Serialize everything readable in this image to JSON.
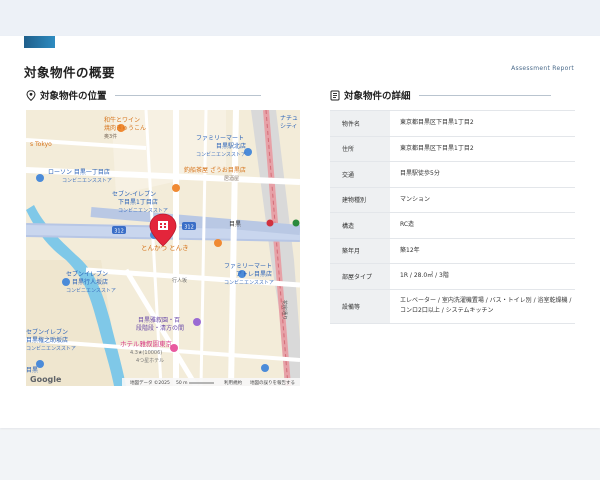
{
  "header": {
    "page_title": "対象物件の概要",
    "report_label": "Assessment Report"
  },
  "location_section": {
    "title": "対象物件の位置"
  },
  "details_section": {
    "title": "対象物件の詳細"
  },
  "details": [
    {
      "key": "物件名",
      "value": "東京都目黒区下目黒1丁目2"
    },
    {
      "key": "住所",
      "value": "東京都目黒区下目黒1丁目2"
    },
    {
      "key": "交通",
      "value": "目黒駅徒歩5分"
    },
    {
      "key": "建物種別",
      "value": "マンション"
    },
    {
      "key": "構造",
      "value": "RC造"
    },
    {
      "key": "築年月",
      "value": "築12年"
    },
    {
      "key": "部屋タイプ",
      "value": "1R / 28.0㎡ / 3階"
    },
    {
      "key": "設備等",
      "value": "エレベーター / 室内洗濯機置場 / バス・トイレ別 / 浴室乾燥機 / コンロ2口以上 / システムキッチン"
    }
  ],
  "map": {
    "labels": {
      "wine_bar": "和牛とワイン",
      "wine_bar2": "焼肉きゅうこん",
      "wine_bar3": "奥3件",
      "tokyo": "s Tokyo",
      "lawson": "ローソン 目黒一丁目店",
      "lawson_sub": "コンビニエンスストア",
      "famima_top": "ファミリーマート",
      "famima_top2": "目黒駅北店",
      "famima_top_sub": "コンビニエンスストア",
      "chitose": "ナチュ",
      "chitose2": "シティ",
      "ryotei": "釣船茶屋 ざうお目黒店",
      "ryotei_sub": "居酒屋",
      "seven_top": "セブン-イレブン",
      "seven_top2": "下目黒1丁目店",
      "seven_top_sub": "コンビニエンスストア",
      "tonki": "とんかつ とんき",
      "meguro_station": "目黒",
      "route312": "312",
      "famima_mid": "ファミリーマート",
      "famima_mid2": "アトレ目黒店",
      "famima_mid_sub": "コンビニエンスストア",
      "seven_mid": "セブンイレブン",
      "seven_mid2": "目黒行人坂店",
      "seven_mid_sub": "コンビニエンスストア",
      "gyonin": "行人坂",
      "gajoen": "目黒雅叙園・百",
      "gajoen2": "段階段・清方の間",
      "seven_bot": "セブンイレブン",
      "seven_bot2": "目黒権之助坂店",
      "seven_bot_sub": "コンビニエンスストア",
      "hotel": "ホテル雅叙園東京",
      "hotel_rating": "4.3★(10006)",
      "hotel_sub": "4つ星ホテル",
      "hanabusa": "花房通り",
      "meguro_ku": "目黒",
      "google": "Google",
      "copyright": "地図データ ©2025",
      "scale": "50 m",
      "terms": "利用規約",
      "report": "地図の誤りを報告する"
    }
  }
}
